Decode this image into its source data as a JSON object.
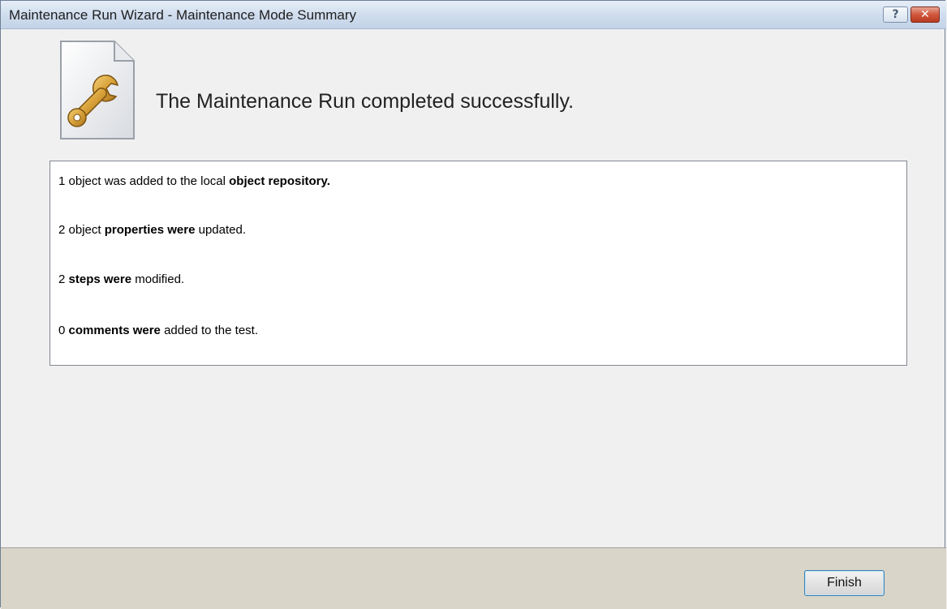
{
  "window": {
    "title": "Maintenance Run Wizard - Maintenance Mode Summary",
    "help_label": "?",
    "close_label": "✕"
  },
  "header": {
    "icon": "wrench-document-icon",
    "message": "The Maintenance Run completed successfully."
  },
  "summary": [
    {
      "pre": "1 object was added to the local ",
      "bold": "object repository.",
      "post": ""
    },
    {
      "pre": "2 object ",
      "bold": "properties were",
      "post": " updated."
    },
    {
      "pre": "2 ",
      "bold": "steps were",
      "post": " modified."
    },
    {
      "pre": "0 ",
      "bold": "comments were",
      "post": " added to the test."
    }
  ],
  "footer": {
    "finish_label": "Finish"
  }
}
